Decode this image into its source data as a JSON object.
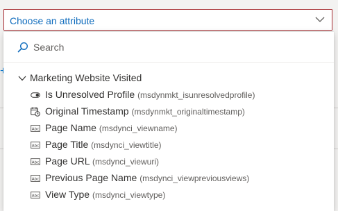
{
  "select": {
    "placeholder": "Choose an attribute"
  },
  "dropdown": {
    "search_placeholder": "Search",
    "group": {
      "label": "Marketing Website Visited",
      "items": [
        {
          "label": "Is Unresolved Profile",
          "code": "(msdynmkt_isunresolvedprofile)",
          "icon": "toggle-icon"
        },
        {
          "label": "Original Timestamp",
          "code": "(msdynmkt_originaltimestamp)",
          "icon": "calendar-clock-icon"
        },
        {
          "label": "Page Name",
          "code": "(msdynci_viewname)",
          "icon": "text-field-icon"
        },
        {
          "label": "Page Title",
          "code": "(msdynci_viewtitle)",
          "icon": "text-field-icon"
        },
        {
          "label": "Page URL",
          "code": "(msdynci_viewuri)",
          "icon": "text-field-icon"
        },
        {
          "label": "Previous Page Name",
          "code": "(msdynci_viewpreviousviews)",
          "icon": "text-field-icon"
        },
        {
          "label": "View Type",
          "code": "(msdynci_viewtype)",
          "icon": "text-field-icon"
        }
      ]
    }
  },
  "colors": {
    "accent": "#0f6cbd",
    "error_border": "#a4262c",
    "text": "#323130"
  }
}
